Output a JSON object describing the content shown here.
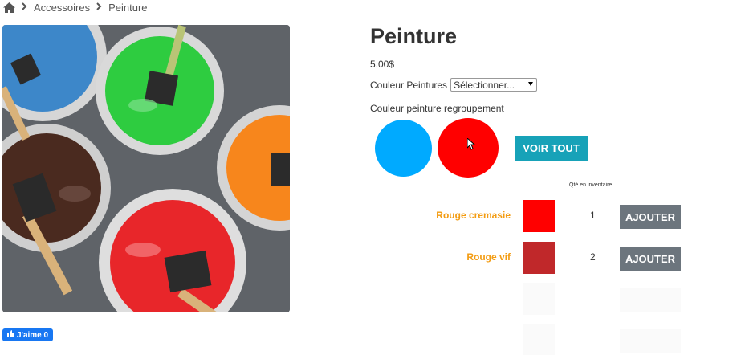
{
  "breadcrumb": {
    "items": [
      {
        "label": "Accessoires"
      },
      {
        "label": "Peinture"
      }
    ]
  },
  "product": {
    "title": "Peinture",
    "price": "5.00$",
    "color_select_label": "Couleur Peintures",
    "color_select_value": "Sélectionner...",
    "group_label": "Couleur peinture regroupement",
    "swatches": [
      {
        "name": "blue",
        "color": "#00aaff"
      },
      {
        "name": "red",
        "color": "#ff0000"
      }
    ],
    "view_all_label": "VOIR TOUT"
  },
  "variants": {
    "stock_header": "Qté en inventaire",
    "rows": [
      {
        "name": "Rouge cremasie",
        "color": "#ff0000",
        "qty": "1",
        "button": "AJOUTER"
      },
      {
        "name": "Rouge vif",
        "color": "#c0282a",
        "qty": "2",
        "button": "AJOUTER"
      }
    ]
  },
  "social": {
    "like_label": "J'aime 0"
  },
  "colors": {
    "accent_teal": "#17a2b8",
    "accent_orange": "#f39c12",
    "button_gray": "#6c757d",
    "facebook_blue": "#1877f2"
  }
}
